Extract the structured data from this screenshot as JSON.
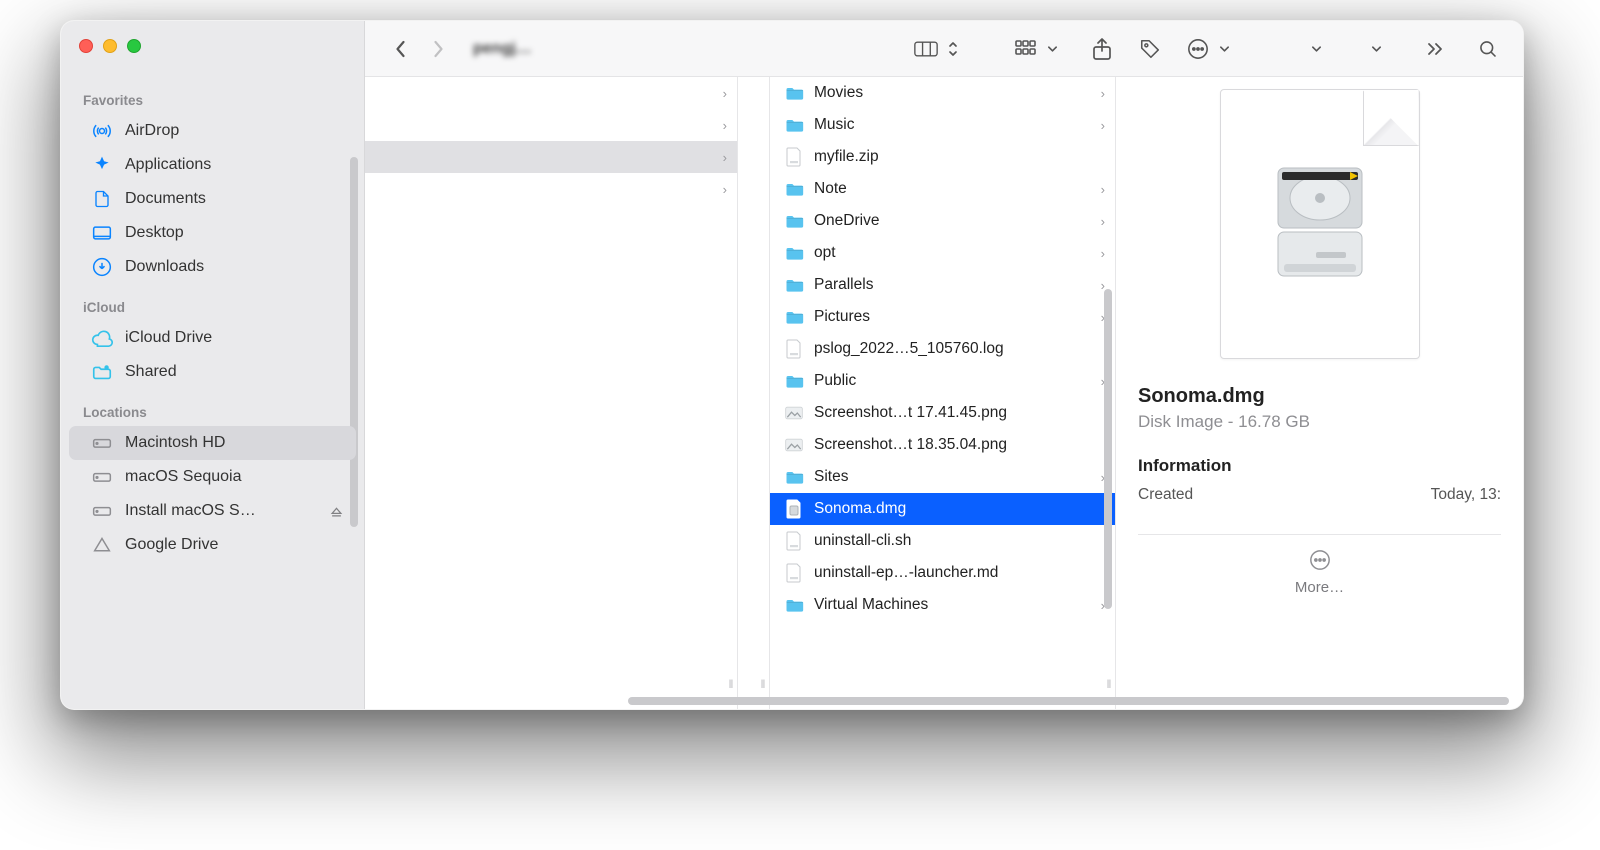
{
  "toolbar": {
    "title": "pengj…"
  },
  "sidebar": {
    "sections": [
      {
        "title": "Favorites",
        "items": [
          "AirDrop",
          "Applications",
          "Documents",
          "Desktop",
          "Downloads"
        ]
      },
      {
        "title": "iCloud",
        "items": [
          "iCloud Drive",
          "Shared"
        ]
      },
      {
        "title": "Locations",
        "items": [
          "Macintosh HD",
          "macOS Sequoia",
          "Install macOS S…",
          "Google Drive"
        ]
      }
    ]
  },
  "column3": [
    {
      "name": "Movies",
      "type": "folder",
      "chev": true
    },
    {
      "name": "Music",
      "type": "folder",
      "chev": true
    },
    {
      "name": "myfile.zip",
      "type": "zip",
      "chev": false
    },
    {
      "name": "Note",
      "type": "folder",
      "chev": true
    },
    {
      "name": "OneDrive",
      "type": "folder",
      "chev": true
    },
    {
      "name": "opt",
      "type": "folder",
      "chev": true
    },
    {
      "name": "Parallels",
      "type": "folder",
      "chev": true
    },
    {
      "name": "Pictures",
      "type": "folder",
      "chev": true
    },
    {
      "name": "pslog_2022…5_105760.log",
      "type": "log",
      "chev": false
    },
    {
      "name": "Public",
      "type": "folder",
      "chev": true
    },
    {
      "name": "Screenshot…t 17.41.45.png",
      "type": "png",
      "chev": false
    },
    {
      "name": "Screenshot…t 18.35.04.png",
      "type": "png",
      "chev": false
    },
    {
      "name": "Sites",
      "type": "folder",
      "chev": true
    },
    {
      "name": "Sonoma.dmg",
      "type": "dmg",
      "chev": false,
      "selected": true
    },
    {
      "name": "uninstall-cli.sh",
      "type": "sh",
      "chev": false
    },
    {
      "name": "uninstall-ep…-launcher.md",
      "type": "md",
      "chev": false
    },
    {
      "name": "Virtual Machines",
      "type": "folder",
      "chev": true
    }
  ],
  "preview": {
    "name": "Sonoma.dmg",
    "kind": "Disk Image",
    "size": "16.78 GB",
    "info_title": "Information",
    "rows": [
      {
        "k": "Created",
        "v": "Today, 13:"
      }
    ],
    "more": "More…"
  },
  "icons": {
    "folder_color": "#58c3ef"
  }
}
